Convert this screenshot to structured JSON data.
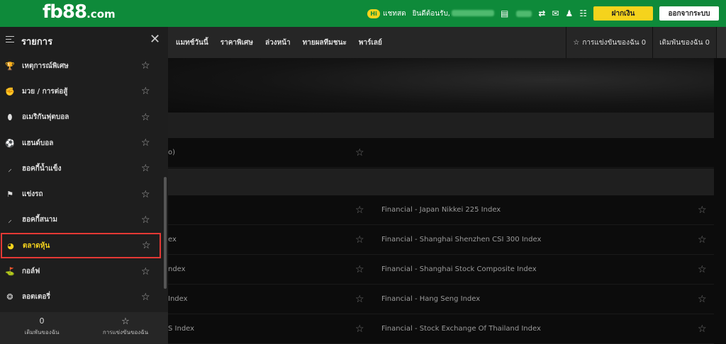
{
  "header": {
    "logo_main": "fb88",
    "logo_suffix": ".com",
    "chat_badge": "Hi",
    "chat_label": "แชทสด",
    "welcome": "ยินดีต้อนรับ,",
    "deposit_label": "ฝากเงิน",
    "logout_label": "ออกจากระบบ"
  },
  "nav": {
    "items": [
      "แมทช์วันนี้",
      "ราคาพิเศษ",
      "ล่วงหน้า",
      "ทายผลทีมชนะ",
      "พาร์เลย์"
    ],
    "my_competitions": "การแข่งขันของฉัน 0",
    "my_bets": "เดิมพันของฉัน 0"
  },
  "sidebar": {
    "title": "รายการ",
    "items": [
      {
        "label": "เหตุการณ์พิเศษ",
        "icon": "trophy-icon"
      },
      {
        "label": "มวย / การต่อสู้",
        "icon": "boxing-glove-icon"
      },
      {
        "label": "อเมริกันฟุตบอล",
        "icon": "american-football-icon"
      },
      {
        "label": "แฮนด์บอล",
        "icon": "handball-icon"
      },
      {
        "label": "ฮอคกี้น้ำแข็ง",
        "icon": "ice-hockey-icon"
      },
      {
        "label": "แข่งรถ",
        "icon": "racing-flag-icon"
      },
      {
        "label": "ฮอคกี้สนาม",
        "icon": "field-hockey-icon"
      },
      {
        "label": "ตลาดหุ้น",
        "icon": "stock-market-icon"
      },
      {
        "label": "กอล์ฟ",
        "icon": "golf-icon"
      },
      {
        "label": "ลอตเตอรี่",
        "icon": "lottery-icon"
      }
    ],
    "footer": {
      "bets_count": "0",
      "bets_label": "เดิมพันของฉัน",
      "competitions_label": "การแข่งขันของฉัน"
    }
  },
  "main": {
    "partial_row_text": "o)",
    "rows": [
      {
        "left": "",
        "right": "Financial - Japan Nikkei 225 Index"
      },
      {
        "left": "ex",
        "right": "Financial - Shanghai Shenzhen CSI 300 Index"
      },
      {
        "left": "ndex",
        "right": "Financial - Shanghai Stock Composite Index"
      },
      {
        "left": "Index",
        "right": "Financial - Hang Seng Index"
      },
      {
        "left": "S Index",
        "right": "Financial - Stock Exchange Of Thailand Index"
      }
    ]
  },
  "colors": {
    "brand_green": "#0e8a3a",
    "accent_yellow": "#f5d31c",
    "highlight_red": "#e53935"
  }
}
